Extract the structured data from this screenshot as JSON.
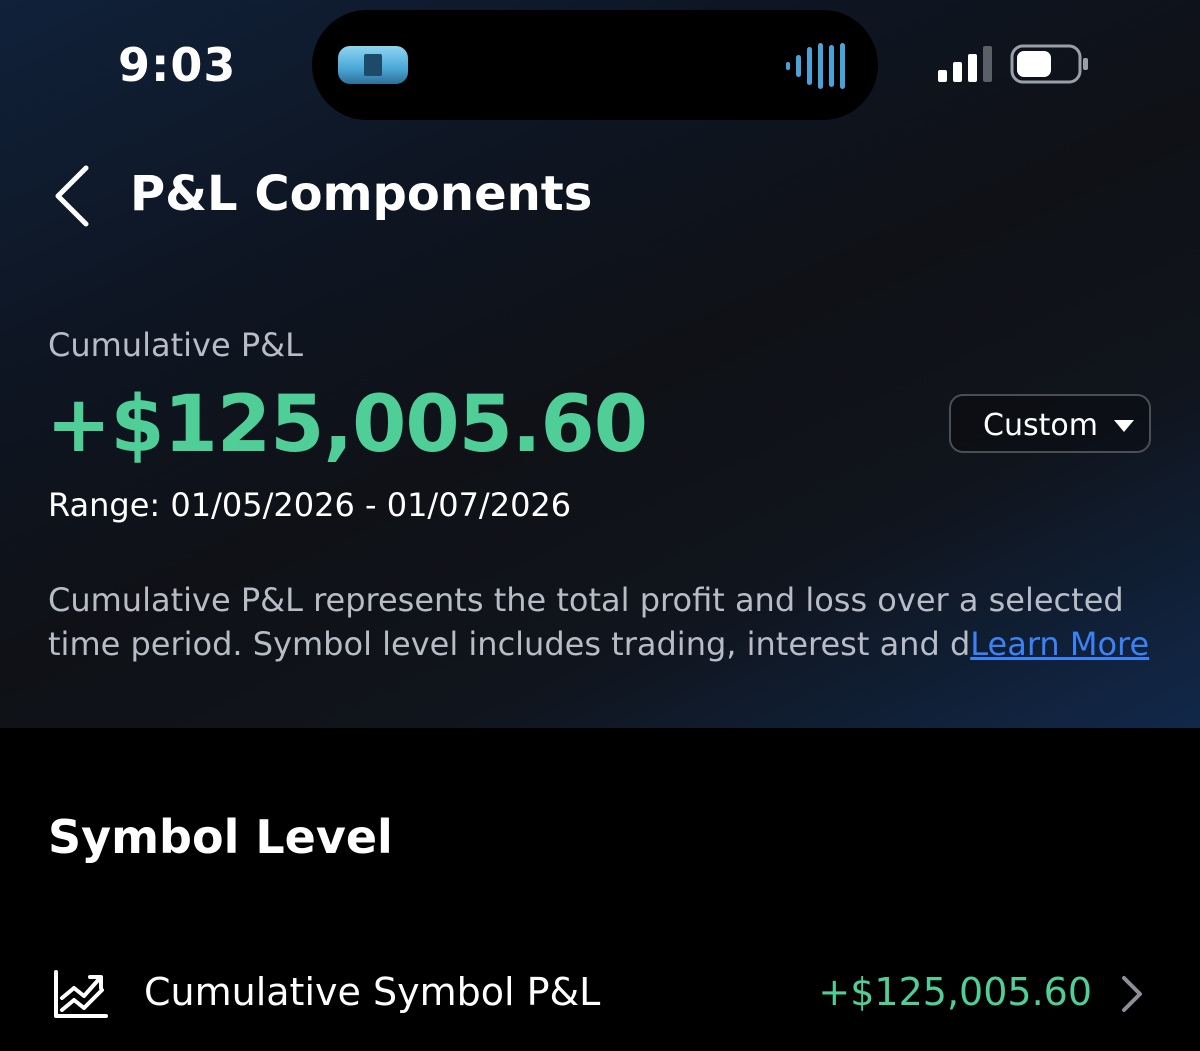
{
  "status_bar": {
    "time": "9:03"
  },
  "header": {
    "title": "P&L Components"
  },
  "summary": {
    "label": "Cumulative P&L",
    "value": "+$125,005.60",
    "range": "Range: 01/05/2026 - 01/07/2026",
    "period_selector": "Custom",
    "description": "Cumulative P&L represents the total profit and loss over a selected time period. Symbol level includes trading, interest and d",
    "learn_more": "Learn More"
  },
  "symbol_level": {
    "title": "Symbol Level",
    "rows": [
      {
        "label": "Cumulative Symbol P&L",
        "value": "+$125,005.60",
        "icon": "trend-chart-icon"
      }
    ]
  },
  "colors": {
    "positive": "#4fcf97",
    "link": "#3b82f6",
    "muted_text": "#b7bcc6"
  }
}
